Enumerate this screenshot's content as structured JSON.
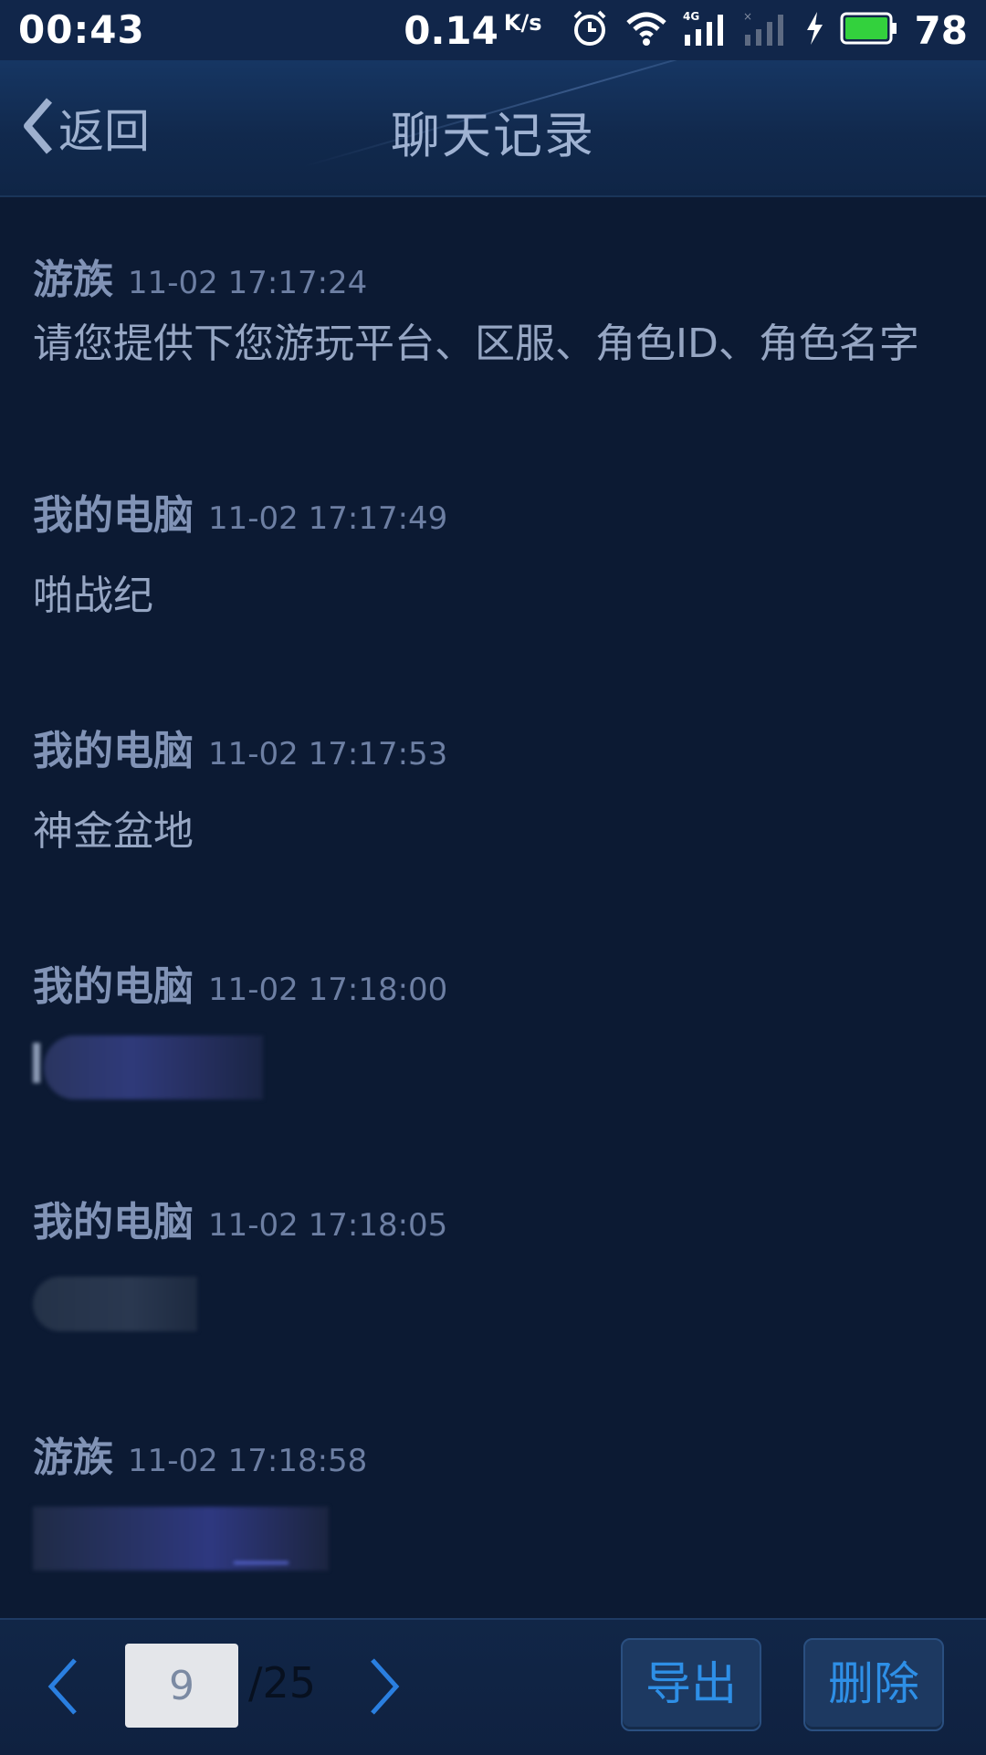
{
  "status_bar": {
    "time": "00:43",
    "net_speed": "0.14",
    "net_unit": "K/s",
    "network_type": "4G",
    "battery_percent": "78"
  },
  "header": {
    "back_label": "返回",
    "title": "聊天记录"
  },
  "messages": [
    {
      "sender": "游族",
      "time": "11-02 17:17:24",
      "text": "请您提供下您游玩平台、区服、角色ID、角色名字"
    },
    {
      "sender": "我的电脑",
      "time": "11-02 17:17:49",
      "text": "啪战纪"
    },
    {
      "sender": "我的电脑",
      "time": "11-02 17:17:53",
      "text": "神金盆地"
    },
    {
      "sender": "我的电脑",
      "time": "11-02 17:18:00",
      "text": ""
    },
    {
      "sender": "我的电脑",
      "time": "11-02 17:18:05",
      "text": ""
    },
    {
      "sender": "游族",
      "time": "11-02 17:18:58",
      "text": ""
    }
  ],
  "pagination": {
    "current_page": "9",
    "total_pages": "/25"
  },
  "actions": {
    "export_label": "导出",
    "delete_label": "删除"
  },
  "colors": {
    "background": "#0c1a33",
    "header": "#11294d",
    "accent": "#2e8fe6"
  }
}
